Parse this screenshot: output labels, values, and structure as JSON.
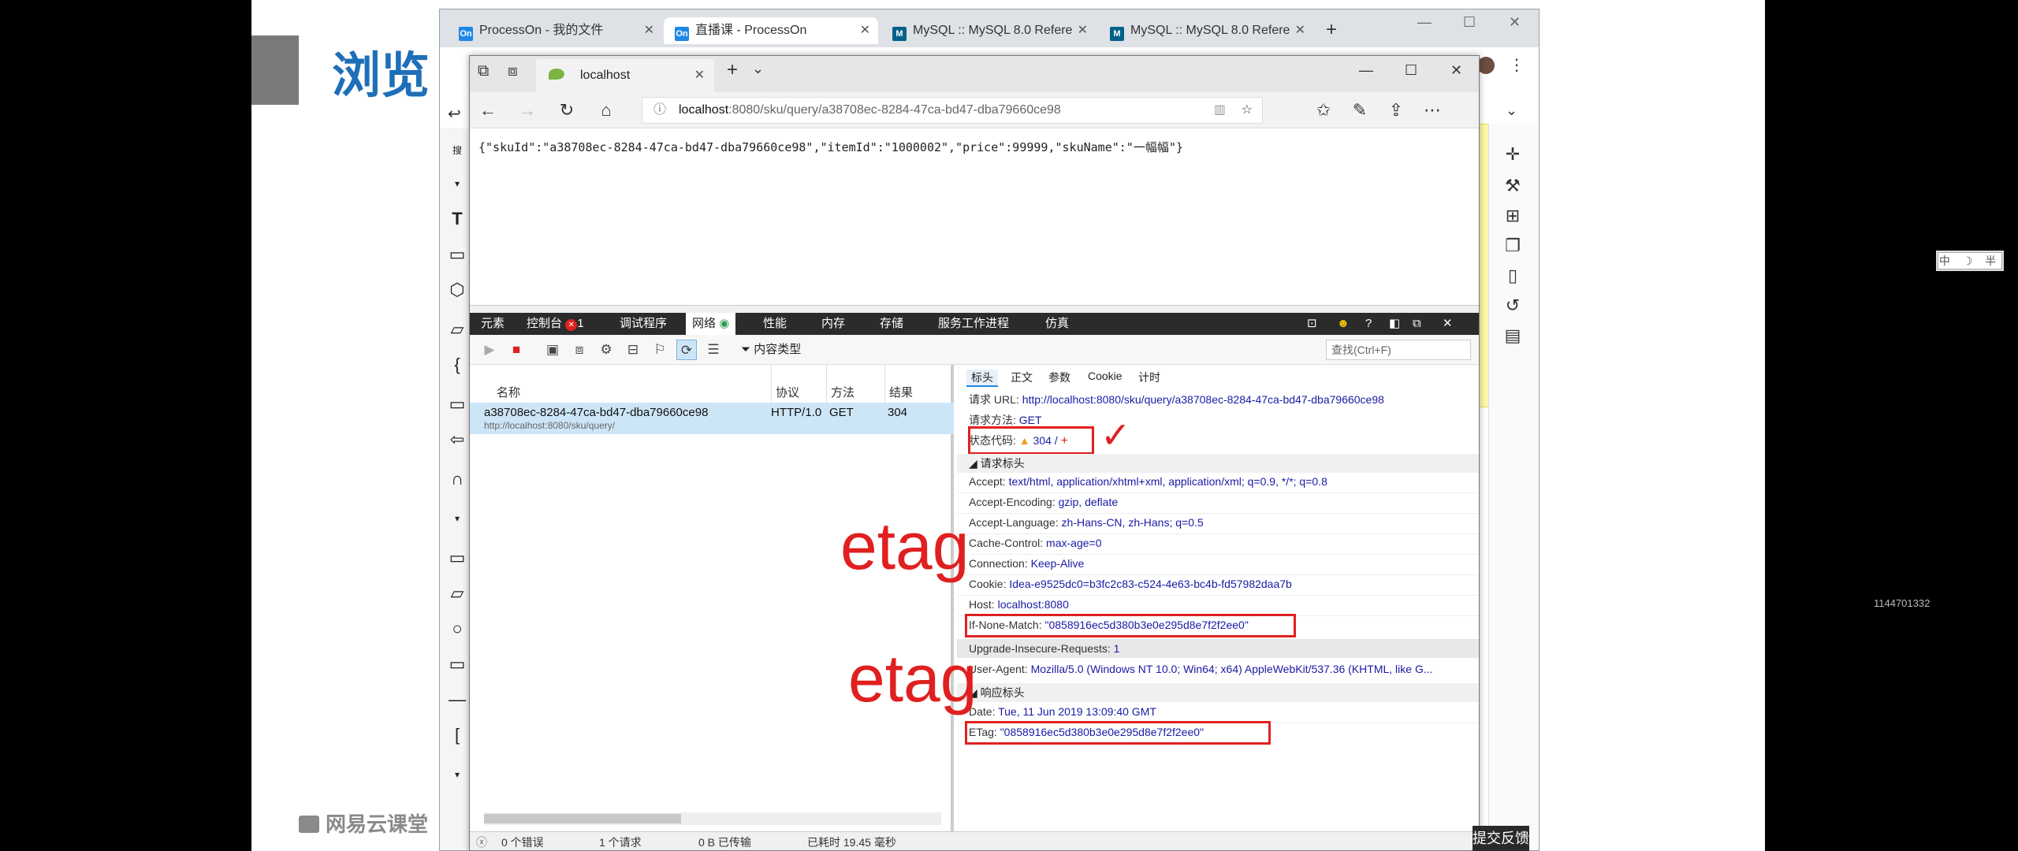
{
  "slide": {
    "title": "浏览",
    "watermark": "网易云课堂",
    "faint_number": "1144701332",
    "ime_indicator": "中 ☽ 半"
  },
  "back_browser": {
    "tabs": [
      {
        "label": "ProcessOn - 我的文件",
        "favicon": "On"
      },
      {
        "label": "直播课 - ProcessOn",
        "favicon": "On"
      },
      {
        "label": "MySQL :: MySQL 8.0 Refere",
        "favicon": "M"
      },
      {
        "label": "MySQL :: MySQL 8.0 Refere",
        "favicon": "M"
      }
    ],
    "new_tab": "+",
    "feedback_button": "提交反馈"
  },
  "edge": {
    "tab_label": "localhost",
    "address": "localhost:8080/sku/query/a38708ec-8284-47ca-bd47-dba79660ce98",
    "address_host": "localhost",
    "address_rest": ":8080/sku/query/a38708ec-8284-47ca-bd47-dba79660ce98",
    "json_body": "{\"skuId\":\"a38708ec-8284-47ca-bd47-dba79660ce98\",\"itemId\":\"1000002\",\"price\":99999,\"skuName\":\"一幅幅\"}"
  },
  "devtools": {
    "menu": [
      "元素",
      "控制台",
      "调试程序",
      "网络",
      "性能",
      "内存",
      "存储",
      "服务工作进程",
      "仿真"
    ],
    "console_errors": "1",
    "content_type_filter": "内容类型",
    "find_placeholder": "查找(Ctrl+F)",
    "columns": [
      "名称",
      "协议",
      "方法",
      "结果"
    ],
    "request": {
      "name": "a38708ec-8284-47ca-bd47-dba79660ce98",
      "path": "http://localhost:8080/sku/query/",
      "protocol": "HTTP/1.0",
      "method": "GET",
      "result": "304"
    },
    "detail_tabs": [
      "标头",
      "正文",
      "参数",
      "Cookie",
      "计时"
    ],
    "general": {
      "url_label": "请求 URL:",
      "url": "http://localhost:8080/sku/query/a38708ec-8284-47ca-bd47-dba79660ce98",
      "method_label": "请求方法:",
      "method": "GET",
      "status_label": "状态代码:",
      "status": "304 /"
    },
    "request_headers_title": "请求标头",
    "request_headers": [
      {
        "k": "Accept:",
        "v": "text/html, application/xhtml+xml, application/xml; q=0.9, */*; q=0.8"
      },
      {
        "k": "Accept-Encoding:",
        "v": "gzip, deflate"
      },
      {
        "k": "Accept-Language:",
        "v": "zh-Hans-CN, zh-Hans; q=0.5"
      },
      {
        "k": "Cache-Control:",
        "v": "max-age=0"
      },
      {
        "k": "Connection:",
        "v": "Keep-Alive"
      },
      {
        "k": "Cookie:",
        "v": "Idea-e9525dc0=b3fc2c83-c524-4e63-bc4b-fd57982daa7b"
      },
      {
        "k": "Host:",
        "v": "localhost:8080"
      },
      {
        "k": "If-None-Match:",
        "v": "\"0858916ec5d380b3e0e295d8e7f2f2ee0\""
      },
      {
        "k": "Upgrade-Insecure-Requests:",
        "v": "1"
      },
      {
        "k": "User-Agent:",
        "v": "Mozilla/5.0 (Windows NT 10.0; Win64; x64) AppleWebKit/537.36 (KHTML, like G..."
      }
    ],
    "response_headers_title": "响应标头",
    "response_headers": [
      {
        "k": "Date:",
        "v": "Tue, 11 Jun 2019 13:09:40 GMT"
      },
      {
        "k": "ETag:",
        "v": "\"0858916ec5d380b3e0e295d8e7f2f2ee0\""
      }
    ],
    "status_bar": {
      "errors": "0 个错误",
      "requests": "1 个请求",
      "transferred": "0 B 已传输",
      "elapsed": "已耗时 19.45 毫秒"
    }
  },
  "annotations": {
    "etag_label_1": "etag",
    "etag_label_2": "etag",
    "check_mark": "✓"
  },
  "colors": {
    "annotation_red": "#e02020",
    "slide_title_blue": "#1e6fb8"
  }
}
